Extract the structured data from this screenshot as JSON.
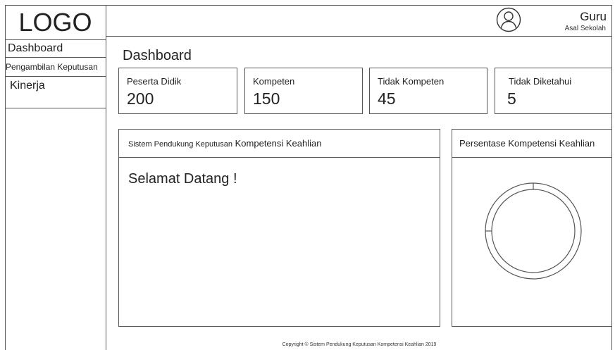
{
  "sidebar": {
    "logo": "LOGO",
    "items": [
      {
        "label": "Dashboard"
      },
      {
        "label": "Pengambilan Keputusan"
      },
      {
        "label": "Kinerja"
      }
    ]
  },
  "header": {
    "user_icon": "user-circle-icon",
    "user_name": "Guru",
    "user_school": "Asal Sekolah"
  },
  "main": {
    "title": "Dashboard",
    "stats": [
      {
        "label": "Peserta Didik",
        "value": "200"
      },
      {
        "label": "Kompeten",
        "value": "150"
      },
      {
        "label": "Tidak Kompeten",
        "value": "45"
      },
      {
        "label": "Tidak Diketahui",
        "value": "5"
      }
    ],
    "left_panel": {
      "title_small": "Sistem Pendukung Keputusan",
      "title_rest": "Kompetensi Keahlian",
      "welcome": "Selamat Datang !"
    },
    "right_panel": {
      "title": "Persentase Kompetensi Keahlian"
    }
  },
  "footer": {
    "text": "Copyright © Sistem Pendukung Keputusan Kompetensi Keahlian 2019"
  },
  "colors": {
    "line": "#555555",
    "text": "#222222",
    "background": "#ffffff"
  }
}
